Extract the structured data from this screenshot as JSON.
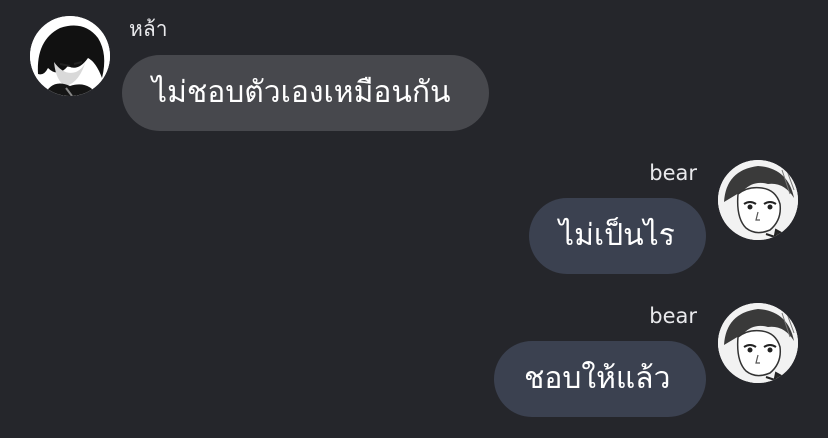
{
  "messages": [
    {
      "direction": "incoming",
      "sender": "หล้า",
      "text": "ไม่ชอบตัวเองเหมือนกัน"
    },
    {
      "direction": "outgoing",
      "sender": "bear",
      "text": "ไม่เป็นไร"
    },
    {
      "direction": "outgoing",
      "sender": "bear",
      "text": "ชอบให้แล้ว"
    }
  ],
  "colors": {
    "background": "#25262b",
    "incoming_bubble": "#47484d",
    "outgoing_bubble": "#3b4150",
    "text": "#ffffff"
  },
  "icons": {
    "incoming_avatar": "avatar-dark-hair-icon",
    "outgoing_avatar": "avatar-manga-sketch-icon"
  }
}
